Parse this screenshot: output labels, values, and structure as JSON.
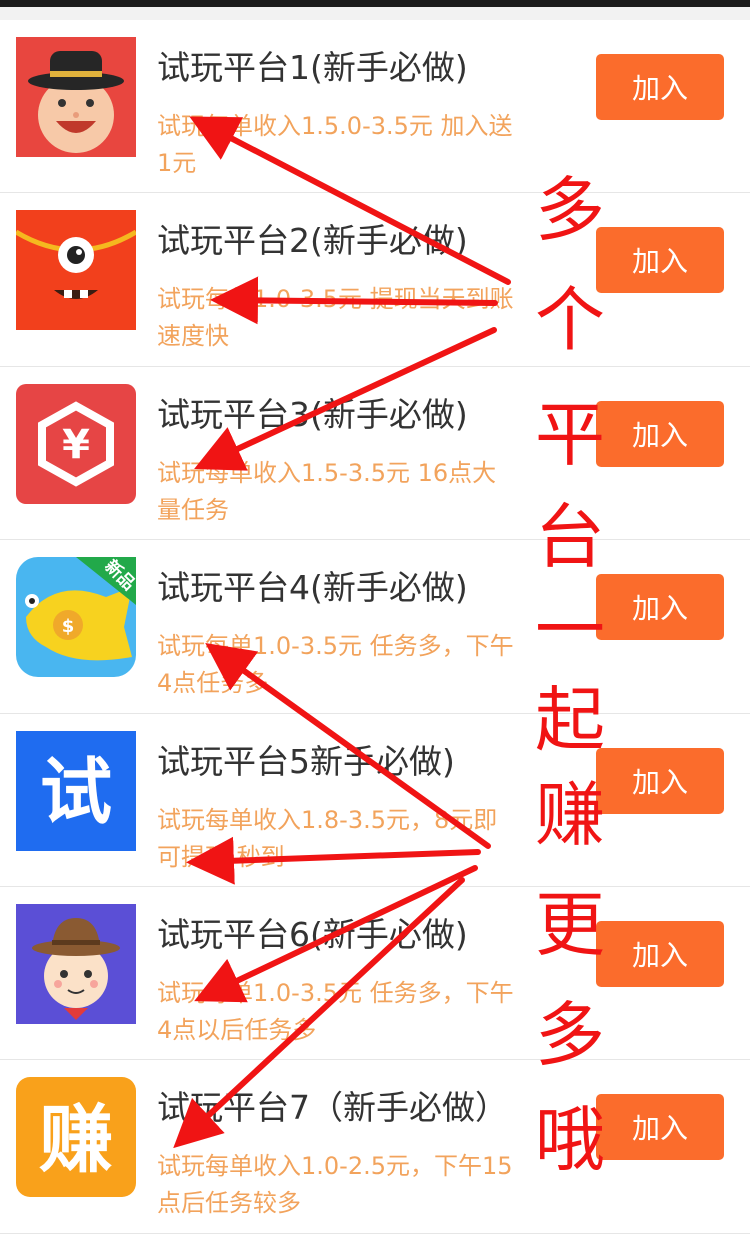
{
  "items": [
    {
      "title": "试玩平台1(新手必做)",
      "desc": "试玩每单收入1.5.0-3.5元 加入送1元",
      "button": "加入"
    },
    {
      "title": "试玩平台2(新手必做)",
      "desc": "试玩每单1.0-3.5元 提现当天到账速度快",
      "button": "加入"
    },
    {
      "title": "试玩平台3(新手必做)",
      "desc": "试玩每单收入1.5-3.5元 16点大量任务",
      "button": "加入"
    },
    {
      "title": "试玩平台4(新手必做)",
      "desc": "试玩每单1.0-3.5元 任务多，下午4点任务多",
      "button": "加入"
    },
    {
      "title": "试玩平台5新手必做)",
      "desc": "试玩每单收入1.8-3.5元，8元即可提现 秒到",
      "button": "加入"
    },
    {
      "title": "试玩平台6(新手必做)",
      "desc": "试玩每单1.0-3.5元 任务多，下午4点以后任务多",
      "button": "加入"
    },
    {
      "title": "试玩平台7（新手必做）",
      "desc": "试玩每单收入1.0-2.5元，下午15点后任务较多",
      "button": "加入"
    }
  ],
  "icons": {
    "app1": "hat-man-face-icon",
    "app2": "one-eyed-monster-icon",
    "app3": "yuan-hexagon-icon",
    "app3_glyph": "¥",
    "app4": "coin-fish-icon",
    "app4_badge": "新品",
    "app4_coin": "$",
    "app5": "shi-character-icon",
    "app5_glyph": "试",
    "app6": "cowboy-kid-icon",
    "app7": "zhuan-character-icon",
    "app7_glyph": "赚"
  },
  "annotation": {
    "chars": [
      "多",
      "个",
      "平",
      "台",
      "一",
      "起",
      "赚",
      "更",
      "多",
      "哦"
    ],
    "color": "#f01414"
  },
  "colors": {
    "button": "#fb6c2c",
    "desc": "#f2a35c",
    "title": "#333333"
  }
}
